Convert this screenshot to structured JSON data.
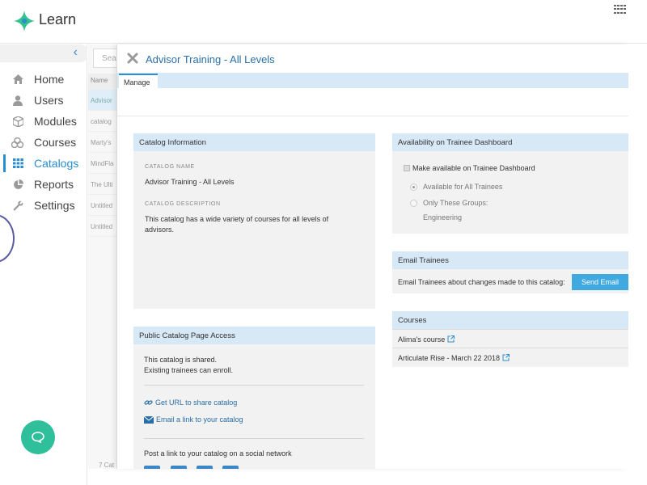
{
  "app": {
    "brand": "Learn"
  },
  "sidebar": {
    "items": [
      {
        "label": "Home",
        "icon": "home-icon"
      },
      {
        "label": "Users",
        "icon": "user-icon"
      },
      {
        "label": "Modules",
        "icon": "cube-icon"
      },
      {
        "label": "Courses",
        "icon": "courses-icon"
      },
      {
        "label": "Catalogs",
        "icon": "grid-icon",
        "active": true
      },
      {
        "label": "Reports",
        "icon": "pie-chart-icon"
      },
      {
        "label": "Settings",
        "icon": "wrench-icon"
      }
    ]
  },
  "list": {
    "search_placeholder": "Sear",
    "column_header": "Name",
    "rows": [
      "Advisor",
      "catalog",
      "Marty's",
      "MindFla",
      "The Ulti",
      "Untitled",
      "Untitled"
    ],
    "footer": "7 Cat"
  },
  "panel": {
    "title": "Advisor Training - All Levels",
    "tab": "Manage",
    "catalog_info": {
      "header": "Catalog Information",
      "name_label": "CATALOG NAME",
      "name_value": "Advisor Training - All Levels",
      "desc_label": "CATALOG DESCRIPTION",
      "desc_value": "This catalog has a wide variety of courses for all levels of advisors."
    },
    "availability": {
      "header": "Availability on Trainee Dashboard",
      "checkbox_label": "Make available on Trainee Dashboard",
      "option_all": "Available for All Trainees",
      "option_groups": "Only These Groups:",
      "group_name": "Engineering"
    },
    "email": {
      "header": "Email Trainees",
      "text": "Email Trainees about changes made to this catalog:",
      "button": "Send Email"
    },
    "courses": {
      "header": "Courses",
      "items": [
        "Alima's course",
        "Articulate Rise - March 22 2018"
      ]
    },
    "public_access": {
      "header": "Public Catalog Page Access",
      "status_line1": "This catalog is shared.",
      "status_line2": "Existing trainees can enroll.",
      "get_url": "Get URL to share catalog",
      "email_link": "Email a link to your catalog",
      "social_text": "Post a link to your catalog on a social network"
    }
  },
  "colors": {
    "accent": "#2a8fd1",
    "header_bg": "#d7e8f6",
    "chat": "#2fbf9a",
    "button": "#3fa9e0"
  }
}
